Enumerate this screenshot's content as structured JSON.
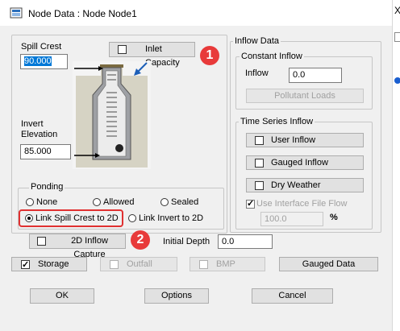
{
  "window": {
    "title": "Node Data : Node Node1",
    "close_glyph": "X"
  },
  "spill_crest": {
    "label": "Spill Crest",
    "value": "90.000"
  },
  "inlet_capacity": {
    "label": "Inlet Capacity"
  },
  "invert": {
    "label_line1": "Invert",
    "label_line2": "Elevation",
    "value": "85.000"
  },
  "ponding": {
    "legend": "Ponding",
    "options": {
      "none": "None",
      "allowed": "Allowed",
      "sealed": "Sealed",
      "link_spill": "Link Spill Crest to 2D",
      "link_invert": "Link Invert to 2D"
    },
    "selected": "link_spill"
  },
  "inflow_data": {
    "legend": "Inflow Data",
    "constant": {
      "legend": "Constant Inflow",
      "inflow_label": "Inflow",
      "inflow_value": "0.0",
      "pollutant_button": "Pollutant Loads"
    },
    "time_series": {
      "legend": "Time Series Inflow",
      "user_inflow": "User Inflow",
      "gauged_inflow": "Gauged Inflow",
      "dry_weather": "Dry Weather",
      "use_interface": "Use Interface File Flow",
      "percent_value": "100.0",
      "percent_unit": "%"
    }
  },
  "inflow_2d": {
    "label": "2D Inflow Capture",
    "initial_depth_label": "Initial Depth",
    "initial_depth_value": "0.0"
  },
  "options_row": {
    "storage": "Storage",
    "outfall": "Outfall",
    "bmp": "BMP",
    "gauged_data": "Gauged Data"
  },
  "footer": {
    "ok": "OK",
    "options": "Options",
    "cancel": "Cancel"
  },
  "annotations": {
    "badge1": "1",
    "badge2": "2",
    "color": "#e83a3a"
  }
}
